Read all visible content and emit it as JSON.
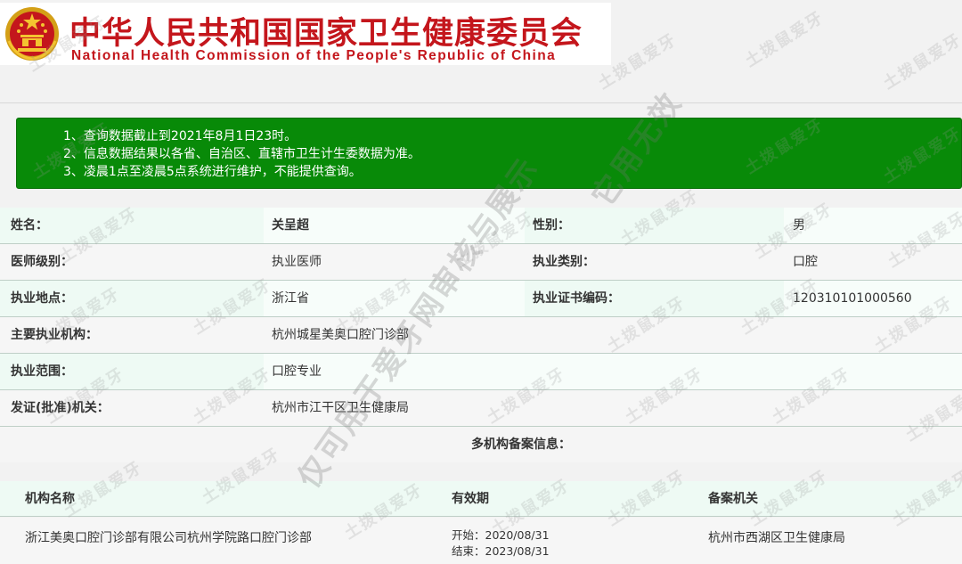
{
  "header": {
    "org_name_cn": "中华人民共和国国家卫生健康委员会",
    "org_name_en": "National Health Commission of the People's Republic of China"
  },
  "notice": {
    "lines": [
      "1、查询数据截止到2021年8月1日23时。",
      "2、信息数据结果以各省、自治区、直辖市卫生计生委数据为准。",
      "3、凌晨1点至凌晨5点系统进行维护，不能提供查询。"
    ]
  },
  "info": {
    "name_label": "姓名：",
    "name_value": "关呈超",
    "gender_label": "性别：",
    "gender_value": "男",
    "level_label": "医师级别：",
    "level_value": "执业医师",
    "category_label": "执业类别：",
    "category_value": "口腔",
    "location_label": "执业地点：",
    "location_value": "浙江省",
    "cert_label": "执业证书编码：",
    "cert_value": "120310101000560",
    "institution_label": "主要执业机构：",
    "institution_value": "杭州城星美奥口腔门诊部",
    "scope_label": "执业范围：",
    "scope_value": "口腔专业",
    "issuer_label": "发证(批准)机关：",
    "issuer_value": "杭州市江干区卫生健康局"
  },
  "multi": {
    "title": "多机构备案信息：",
    "headers": [
      "机构名称",
      "有效期",
      "备案机关"
    ],
    "rows": [
      {
        "name": "浙江美奥口腔门诊部有限公司杭州学院路口腔门诊部",
        "start": "开始：2020/08/31",
        "end": "结束：2023/08/31",
        "authority": "杭州市西湖区卫生健康局"
      }
    ]
  },
  "watermarks": {
    "small": "土拨鼠爱牙",
    "big_line1": "仅可用于爱牙网审核与展示",
    "big_line2": "它用无效"
  },
  "colors": {
    "brand_red": "#c4161c",
    "notice_green": "#088a08",
    "row_mint": "#eefaf4"
  }
}
